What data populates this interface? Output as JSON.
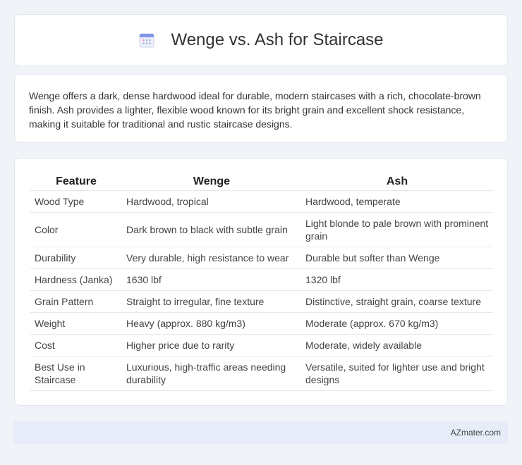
{
  "header": {
    "title": "Wenge vs. Ash for Staircase",
    "icon": "calendar-icon"
  },
  "intro": {
    "text": "Wenge offers a dark, dense hardwood ideal for durable, modern staircases with a rich, chocolate-brown finish. Ash provides a lighter, flexible wood known for its bright grain and excellent shock resistance, making it suitable for traditional and rustic staircase designs."
  },
  "table": {
    "headers": [
      "Feature",
      "Wenge",
      "Ash"
    ],
    "rows": [
      [
        "Wood Type",
        "Hardwood, tropical",
        "Hardwood, temperate"
      ],
      [
        "Color",
        "Dark brown to black with subtle grain",
        "Light blonde to pale brown with prominent grain"
      ],
      [
        "Durability",
        "Very durable, high resistance to wear",
        "Durable but softer than Wenge"
      ],
      [
        "Hardness (Janka)",
        "1630 lbf",
        "1320 lbf"
      ],
      [
        "Grain Pattern",
        "Straight to irregular, fine texture",
        "Distinctive, straight grain, coarse texture"
      ],
      [
        "Weight",
        "Heavy (approx. 880 kg/m3)",
        "Moderate (approx. 670 kg/m3)"
      ],
      [
        "Cost",
        "Higher price due to rarity",
        "Moderate, widely available"
      ],
      [
        "Best Use in Staircase",
        "Luxurious, high-traffic areas needing durability",
        "Versatile, suited for lighter use and bright designs"
      ]
    ]
  },
  "footer": {
    "text": "AZmater.com"
  },
  "colors": {
    "background": "#f0f3f8",
    "card": "#ffffff",
    "footer_bg": "#e6edf8"
  }
}
